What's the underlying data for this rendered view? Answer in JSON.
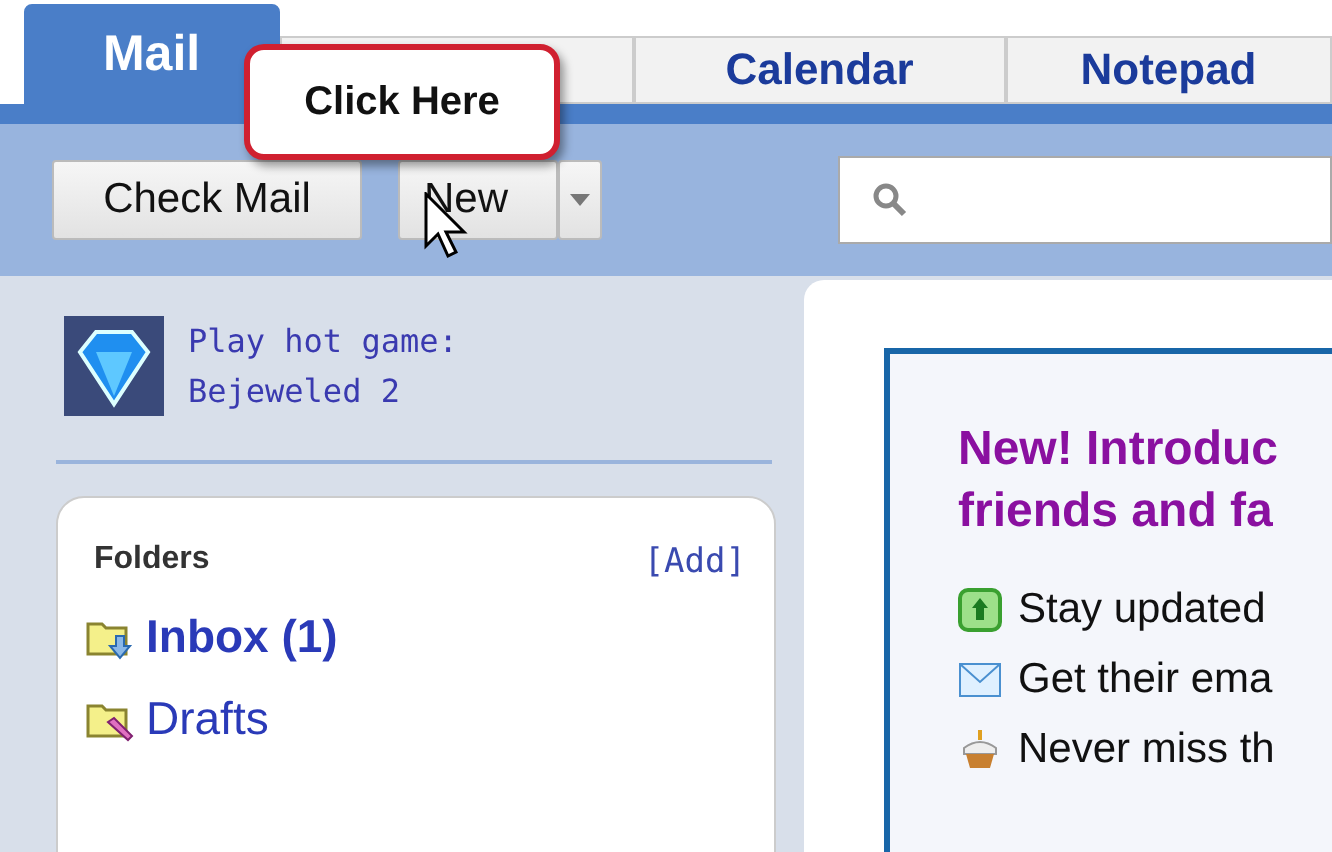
{
  "tabs": [
    {
      "label": "Mail",
      "selected": true
    },
    {
      "selected": false
    },
    {
      "label": "Calendar",
      "selected": false
    },
    {
      "label": "Notepad",
      "selected": false
    }
  ],
  "callout": {
    "text": "Click Here"
  },
  "toolbar": {
    "check_mail": "Check Mail",
    "new": "New"
  },
  "promo_game": {
    "line1": "Play hot game:",
    "line2": "Bejeweled 2"
  },
  "folders": {
    "title": "Folders",
    "add": "[Add]",
    "items": [
      {
        "label": "Inbox (1)",
        "kind": "inbox",
        "unread": true
      },
      {
        "label": "Drafts",
        "kind": "drafts",
        "unread": false
      }
    ]
  },
  "announcement": {
    "title_lines": [
      "New! Introduc",
      "friends and fa"
    ],
    "items": [
      {
        "kind": "update",
        "text": "Stay updated"
      },
      {
        "kind": "email",
        "text": "Get their ema"
      },
      {
        "kind": "birthday",
        "text": "Never miss th"
      }
    ]
  }
}
